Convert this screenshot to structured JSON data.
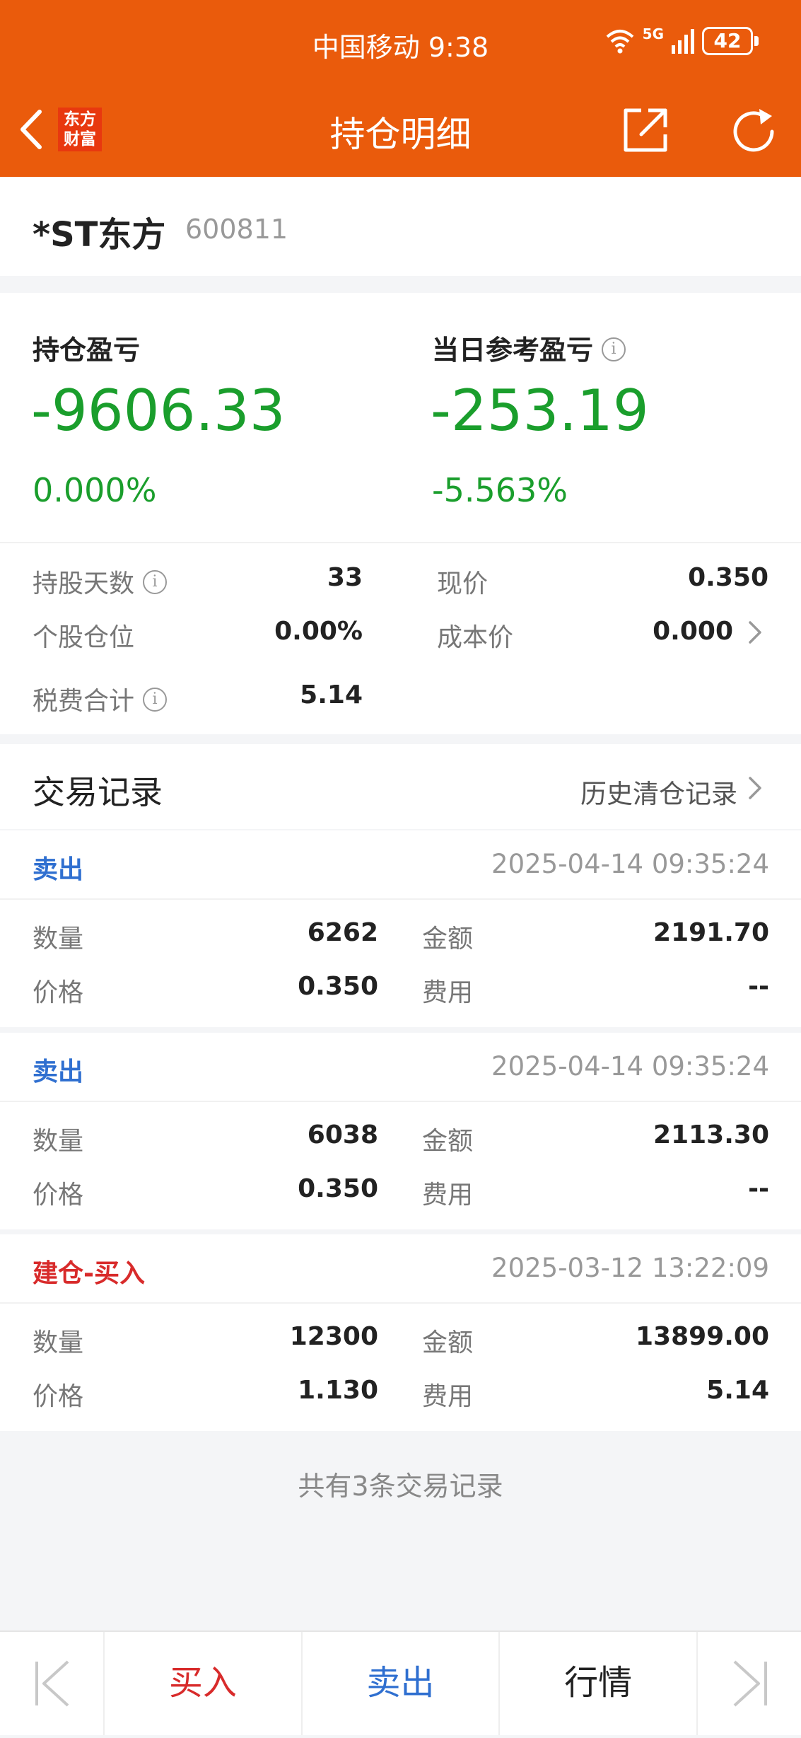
{
  "status_bar": {
    "carrier_time": "中国移动 9:38",
    "network": "5G",
    "battery": "42"
  },
  "nav": {
    "title": "持仓明细",
    "logo_line1": "东方",
    "logo_line2": "财富"
  },
  "stock": {
    "name": "*ST东方",
    "code": "600811"
  },
  "summary": {
    "position_pnl_label": "持仓盈亏",
    "position_pnl_value": "-9606.33",
    "position_pnl_pct": "0.000%",
    "daily_pnl_label": "当日参考盈亏",
    "daily_pnl_value": "-253.19",
    "daily_pnl_pct": "-5.563%",
    "pnl_color": "#1a9e2c",
    "details": {
      "holding_days_label": "持股天数",
      "holding_days": "33",
      "current_price_label": "现价",
      "current_price": "0.350",
      "position_ratio_label": "个股仓位",
      "position_ratio": "0.00%",
      "cost_price_label": "成本价",
      "cost_price": "0.000",
      "fees_label": "税费合计",
      "fees": "5.14"
    }
  },
  "transactions": {
    "title": "交易记录",
    "history_link": "历史清仓记录",
    "labels": {
      "quantity": "数量",
      "amount": "金额",
      "price": "价格",
      "fee": "费用"
    },
    "items": [
      {
        "type": "卖出",
        "time": "2025-04-14 09:35:24",
        "quantity": "6262",
        "amount": "2191.70",
        "price": "0.350",
        "fee": "--"
      },
      {
        "type": "卖出",
        "time": "2025-04-14 09:35:24",
        "quantity": "6038",
        "amount": "2113.30",
        "price": "0.350",
        "fee": "--"
      },
      {
        "type": "建仓-买入",
        "time": "2025-03-12 13:22:09",
        "quantity": "12300",
        "amount": "13899.00",
        "price": "1.130",
        "fee": "5.14"
      }
    ],
    "footer": "共有3条交易记录",
    "sell_color": "#2f6fd0",
    "buy_color": "#d82b2b"
  },
  "bottom_bar": {
    "buy": "买入",
    "sell": "卖出",
    "quote": "行情"
  },
  "colors": {
    "brand": "#ea5b0c"
  },
  "icons": [
    "back-icon",
    "share-icon",
    "refresh-icon",
    "info-icon",
    "chevron-right-icon",
    "first-page-icon",
    "last-page-icon",
    "wifi-icon",
    "signal-icon",
    "battery-icon"
  ]
}
